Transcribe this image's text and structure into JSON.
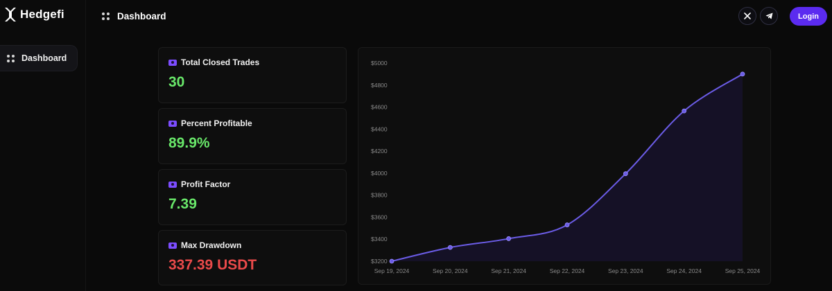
{
  "brand": {
    "name": "Hedgefi",
    "accent": "#5b2bf0"
  },
  "sidebar": {
    "items": [
      {
        "label": "Dashboard",
        "icon": "grid-dots-icon"
      }
    ]
  },
  "header": {
    "title": "Dashboard",
    "social": [
      {
        "name": "x-icon"
      },
      {
        "name": "telegram-icon"
      }
    ],
    "login_label": "Login"
  },
  "stats": [
    {
      "title": "Total Closed Trades",
      "value": "30",
      "tone": "positive"
    },
    {
      "title": "Percent Profitable",
      "value": "89.9%",
      "tone": "positive"
    },
    {
      "title": "Profit Factor",
      "value": "7.39",
      "tone": "positive"
    },
    {
      "title": "Max Drawdown",
      "value": "337.39 USDT",
      "tone": "negative"
    }
  ],
  "chart_data": {
    "type": "area",
    "categories": [
      "Sep 19, 2024",
      "Sep 20, 2024",
      "Sep 21, 2024",
      "Sep 22, 2024",
      "Sep 23, 2024",
      "Sep 24, 2024",
      "Sep 25, 2024"
    ],
    "values": [
      3200,
      3325,
      3405,
      3530,
      3995,
      4565,
      4900
    ],
    "ylim": [
      3200,
      5000
    ],
    "yticks": [
      "$3200",
      "$3400",
      "$3600",
      "$3800",
      "$4000",
      "$4200",
      "$4400",
      "$4600",
      "$4800",
      "$5000"
    ],
    "grid": false,
    "line_color": "#6b5ce7"
  }
}
